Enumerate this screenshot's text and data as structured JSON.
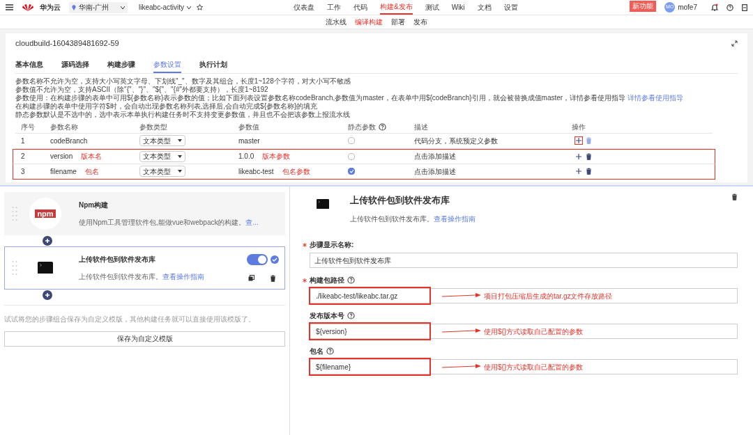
{
  "nav": {
    "brand": "华为云",
    "region": "华南-广州",
    "project": "likeabc-activity",
    "menu": [
      {
        "label": "仪表盘",
        "selected": false
      },
      {
        "label": "工作",
        "selected": false
      },
      {
        "label": "代码",
        "selected": false
      },
      {
        "label": "构建&发布",
        "selected": true
      },
      {
        "label": "测试",
        "selected": false
      },
      {
        "label": "Wiki",
        "selected": false
      },
      {
        "label": "文档",
        "selected": false
      },
      {
        "label": "设置",
        "selected": false
      }
    ],
    "new_badge": "新功能",
    "avatar": "MO",
    "user": "mofe7"
  },
  "subnav": [
    {
      "label": "流水线",
      "selected": false
    },
    {
      "label": "编译构建",
      "selected": true
    },
    {
      "label": "部署",
      "selected": false
    },
    {
      "label": "发布",
      "selected": false
    }
  ],
  "card": {
    "title": "cloudbuild-1604389481692-59",
    "tabs": [
      {
        "label": "基本信息",
        "selected": false
      },
      {
        "label": "源码选择",
        "selected": false
      },
      {
        "label": "构建步骤",
        "selected": false
      },
      {
        "label": "参数设置",
        "selected": true
      },
      {
        "label": "执行计划",
        "selected": false
      }
    ],
    "notes": [
      "参数名称不允许为空，支持大小写英文字母、下划线\"_\"、数字及其组合，长度1~128个字符，对大小写不敏感",
      "参数值不允许为空，支持ASCII（除\"{\"、\"}\"、\"${\"、\"{#\"外都要支持），长度1~8192",
      "参数使用：在构建步骤的表单中可用${参数名称}表示参数的值；比如下面列表设置参数名称codeBranch,参数值为master，在表单中用${codeBranch}引用，就会被替换成值master，详情参看使用指导",
      "在构建步骤的表单中使用字符$时，会自动出现参数名称列表,选择后,会自动完成${参数名称}的填充",
      "静态参数默认是不选中的，选中表示本单执行构建任务时不支持变更参数值，并且也不会把该参数上报流水线"
    ],
    "notes_link": "详情参看使用指导",
    "columns": [
      "序号",
      "参数名称",
      "参数类型",
      "参数值",
      "静态参数",
      "描述",
      "操作"
    ],
    "rows": [
      {
        "index": "1",
        "name": "codeBranch",
        "type": "文本类型",
        "value": "master",
        "static": false,
        "description": "代码分支，系统预定义参数",
        "highlighted": false,
        "add_marked": true
      },
      {
        "index": "2",
        "name": "version",
        "name_note": "版本名",
        "type": "文本类型",
        "value": "1.0.0",
        "value_note": "版本参数",
        "static": false,
        "description": "点击添加描述",
        "highlighted": true,
        "add_marked": false
      },
      {
        "index": "3",
        "name": "filename",
        "name_note": "包名",
        "type": "文本类型",
        "value": "likeabc-test",
        "value_note": "包名参数",
        "static": true,
        "description": "点击添加描述",
        "highlighted": true,
        "add_marked": false
      }
    ]
  },
  "steps": [
    {
      "kind": "npm",
      "logo": "npm",
      "title": "Npm构建",
      "description": "使用Npm工具管理软件包,能做vue和webpack的构建。",
      "link": "查...",
      "selected": false
    },
    {
      "kind": "terminal",
      "title": "上传软件包到软件发布库",
      "description": "上传软件包到软件发布库。",
      "link": "查看操作指南",
      "selected": true,
      "enabled": true
    }
  ],
  "template_hint": "试试将您的步骤组合保存为自定义模版，其他构建任务就可以直接使用该模版了。",
  "template_button": "保存为自定义模版",
  "detail": {
    "title": "上传软件包到软件发布库",
    "description": "上传软件包到软件发布库。",
    "link": "查看操作指南",
    "fields": [
      {
        "label": "步骤显示名称:",
        "required": true,
        "help": false,
        "value": "上传软件包到软件发布库",
        "highlighted": false
      },
      {
        "label": "构建包路径",
        "required": true,
        "help": true,
        "value": "./likeabc-test/likeabc.tar.gz",
        "highlighted": true,
        "annotation": "项目打包压缩后生成的tar.gz文件存放路径"
      },
      {
        "label": "发布版本号",
        "required": false,
        "help": true,
        "value": "${version}",
        "highlighted": true,
        "annotation": "使用${}方式读取自己配置的参数"
      },
      {
        "label": "包名",
        "required": false,
        "help": true,
        "value": "${filename}",
        "highlighted": true,
        "annotation": "使用${}方式读取自己配置的参数"
      }
    ]
  }
}
